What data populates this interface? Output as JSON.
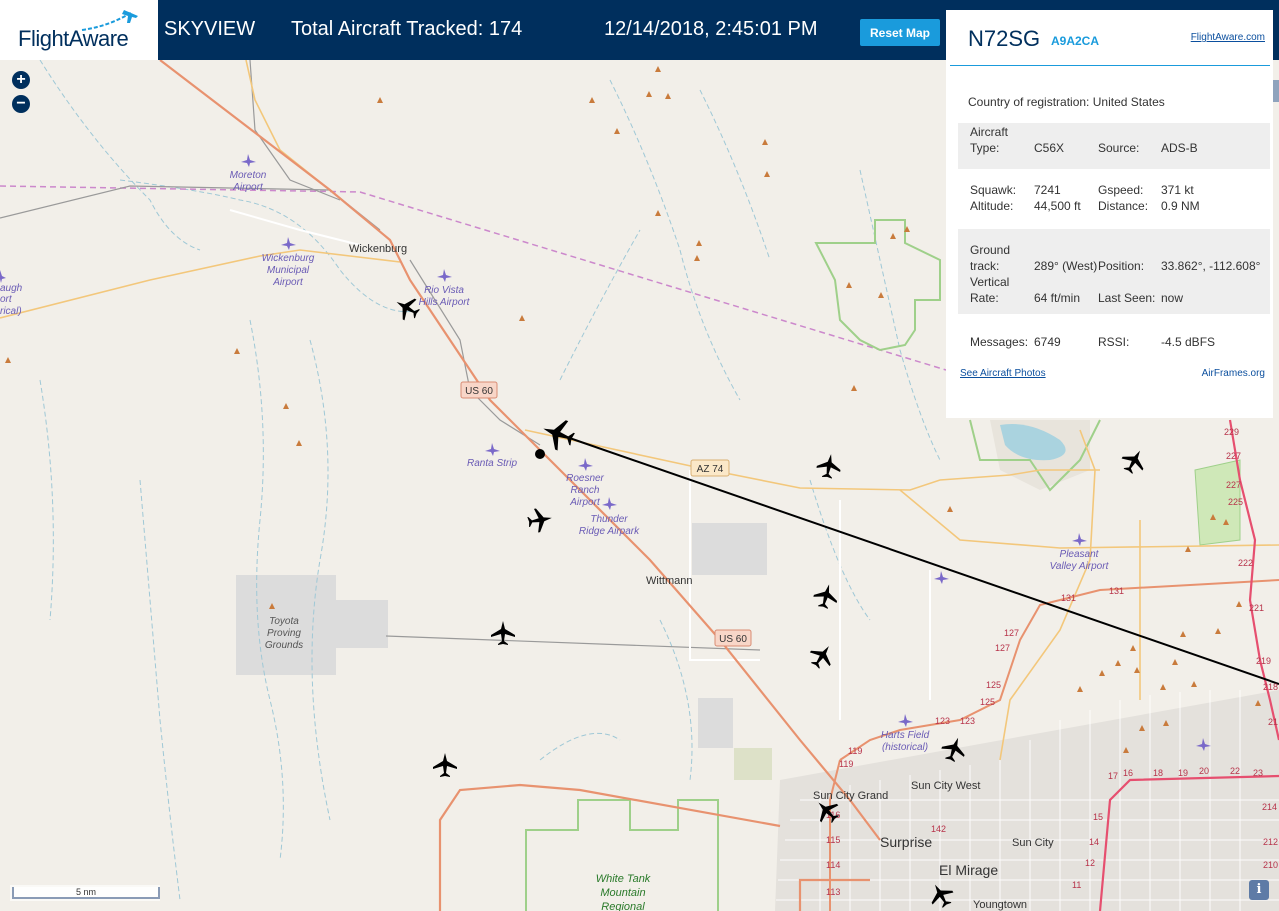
{
  "header": {
    "logo_text": "FlightAware",
    "app_name": "SKYVIEW",
    "total_tracked": "Total Aircraft Tracked: 174",
    "datetime": "12/14/2018, 2:45:01 PM",
    "reset_button": "Reset Map"
  },
  "zoom": {
    "in": "+",
    "out": "−"
  },
  "panel": {
    "registration": "N72SG",
    "hex": "A9A2CA",
    "flightaware_link": "FlightAware.com",
    "country_label": "Country of registration:",
    "country_value": "United States",
    "aircraft_type_label_1": "Aircraft",
    "aircraft_type_label_2": "Type:",
    "aircraft_type": "C56X",
    "source_label": "Source:",
    "source": "ADS-B",
    "squawk_label": "Squawk:",
    "squawk": "7241",
    "gspeed_label": "Gspeed:",
    "gspeed": "371 kt",
    "altitude_label": "Altitude:",
    "altitude": "44,500 ft",
    "distance_label": "Distance:",
    "distance": "0.9 NM",
    "ground_track_label_1": "Ground",
    "ground_track_label_2": "track:",
    "ground_track": "289° (West)",
    "position_label": "Position:",
    "position": "33.862°, -112.608°",
    "vertical_rate_label_1": "Vertical",
    "vertical_rate_label_2": "Rate:",
    "vertical_rate": "64 ft/min",
    "last_seen_label": "Last Seen:",
    "last_seen": "now",
    "messages_label": "Messages:",
    "messages": "6749",
    "rssi_label": "RSSI:",
    "rssi": "-4.5 dBFS",
    "photos_link": "See Aircraft Photos",
    "airframes_link": "AirFrames.org"
  },
  "map": {
    "places": {
      "wickenburg": "Wickenburg",
      "wittmann": "Wittmann",
      "sun_city_grand": "Sun City Grand",
      "sun_city_west": "Sun City West",
      "sun_city": "Sun City",
      "surprise": "Surprise",
      "el_mirage": "El Mirage",
      "youngtown": "Youngtown"
    },
    "airports": {
      "moreton_1": "Moreton",
      "moreton_2": "Airport",
      "wickenburg_1": "Wickenburg",
      "wickenburg_2": "Municipal",
      "wickenburg_3": "Airport",
      "rio_vista_1": "Rio Vista",
      "rio_vista_2": "Hills Airport",
      "ranta": "Ranta Strip",
      "roesner_1": "Roesner",
      "roesner_2": "Ranch",
      "roesner_3": "Airport",
      "thunder_1": "Thunder",
      "thunder_2": "Ridge Airpark",
      "pleasant_1": "Pleasant",
      "pleasant_2": "Valley Airport",
      "harts_1": "Harts Field",
      "harts_2": "(historical)",
      "edge_1": "augh",
      "edge_2": "ort",
      "edge_3": "rical)"
    },
    "areas": {
      "toyota_1": "Toyota",
      "toyota_2": "Proving",
      "toyota_3": "Grounds",
      "whitetank_1": "White Tank",
      "whitetank_2": "Mountain",
      "whitetank_3": "Regional"
    },
    "shields": {
      "us60_a": "US 60",
      "us60_b": "US 60",
      "az74": "AZ 74"
    },
    "exit_numbers": {
      "e229": "229",
      "e227": "227",
      "e225": "225",
      "e222": "222",
      "e221": "221",
      "e219": "219",
      "e131a": "131",
      "e131b": "131",
      "e127a": "127",
      "e127b": "127",
      "e125a": "125",
      "e125b": "125",
      "e123a": "123",
      "e123b": "123",
      "e119a": "119",
      "e119b": "119",
      "e116": "116",
      "e115": "115",
      "e114": "114",
      "e113": "113",
      "e142": "142",
      "e17": "17",
      "e16": "16",
      "e18": "18",
      "e19": "19",
      "e20": "20",
      "e22": "22",
      "e15": "15",
      "e14": "14",
      "e12": "12",
      "e11": "11",
      "e23": "23",
      "e21": "21",
      "e214": "214",
      "e212": "212",
      "e210": "210",
      "e218": "218"
    },
    "scale_label": "5 nm",
    "info_icon": "i"
  },
  "colors": {
    "header_bg": "#002f5d",
    "accent": "#1a9bdc",
    "map_bg": "#f2efe9",
    "highway": "#e8926f",
    "road_yellow": "#f3c77b",
    "park_border": "#9fd08a",
    "river": "#9fc8d6",
    "boundary": "#cc88cc"
  }
}
